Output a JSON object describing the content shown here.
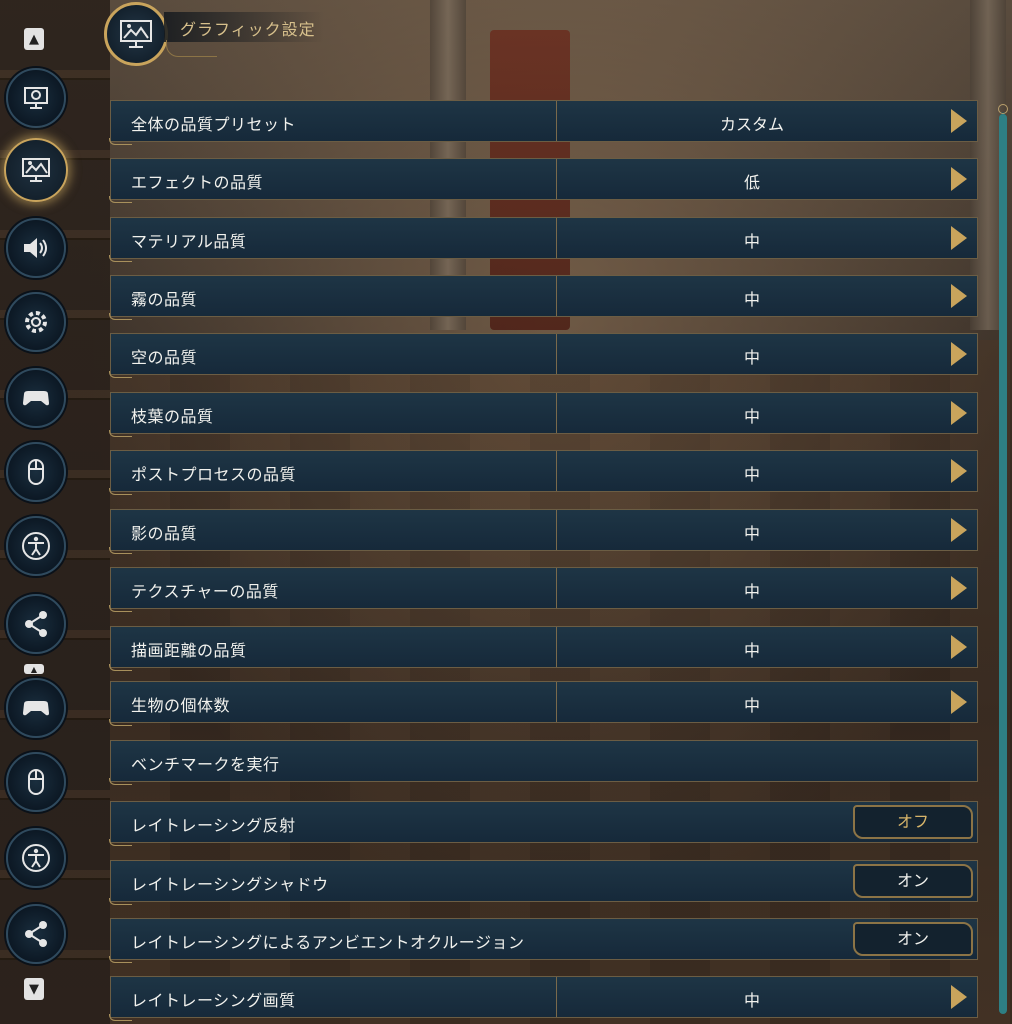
{
  "header": {
    "title": "グラフィック設定",
    "icon": "graphics-monitor-icon"
  },
  "sidebar": {
    "top_arrow": "▲",
    "bottom_arrow": "▼",
    "mid_marker": "▲",
    "items": [
      {
        "name": "display-settings-icon",
        "active": false
      },
      {
        "name": "graphics-monitor-icon",
        "active": true
      },
      {
        "name": "audio-speaker-icon",
        "active": false
      },
      {
        "name": "gameplay-gear-icon",
        "active": false
      },
      {
        "name": "controller-icon",
        "active": false
      },
      {
        "name": "mouse-icon",
        "active": false
      },
      {
        "name": "accessibility-icon",
        "active": false
      },
      {
        "name": "social-share-icon",
        "active": false
      },
      {
        "name": "controller-icon",
        "active": false
      },
      {
        "name": "mouse-icon",
        "active": false
      },
      {
        "name": "accessibility-icon",
        "active": false
      },
      {
        "name": "social-share-icon",
        "active": false
      }
    ]
  },
  "rows": [
    {
      "label": "全体の品質プリセット",
      "value": "カスタム",
      "type": "select"
    },
    {
      "label": "エフェクトの品質",
      "value": "低",
      "type": "select"
    },
    {
      "label": "マテリアル品質",
      "value": "中",
      "type": "select"
    },
    {
      "label": "霧の品質",
      "value": "中",
      "type": "select"
    },
    {
      "label": "空の品質",
      "value": "中",
      "type": "select"
    },
    {
      "label": "枝葉の品質",
      "value": "中",
      "type": "select"
    },
    {
      "label": "ポストプロセスの品質",
      "value": "中",
      "type": "select"
    },
    {
      "label": "影の品質",
      "value": "中",
      "type": "select"
    },
    {
      "label": "テクスチャーの品質",
      "value": "中",
      "type": "select"
    },
    {
      "label": "描画距離の品質",
      "value": "中",
      "type": "select"
    },
    {
      "label": "生物の個体数",
      "value": "中",
      "type": "select"
    },
    {
      "label": "ベンチマークを実行",
      "value": "",
      "type": "action"
    },
    {
      "label": "レイトレーシング反射",
      "value": "オフ",
      "type": "toggle",
      "state": "off"
    },
    {
      "label": "レイトレーシングシャドウ",
      "value": "オン",
      "type": "toggle",
      "state": "on"
    },
    {
      "label": "レイトレーシングによるアンビエントオクルージョン",
      "value": "オン",
      "type": "toggle",
      "state": "on"
    },
    {
      "label": "レイトレーシング画質",
      "value": "中",
      "type": "select"
    }
  ],
  "colors": {
    "accent_gold": "#c9a45c",
    "row_bg": "#1e3545",
    "toggle_off_text": "#d7b56a",
    "scroll_thumb": "#2e7f84"
  }
}
